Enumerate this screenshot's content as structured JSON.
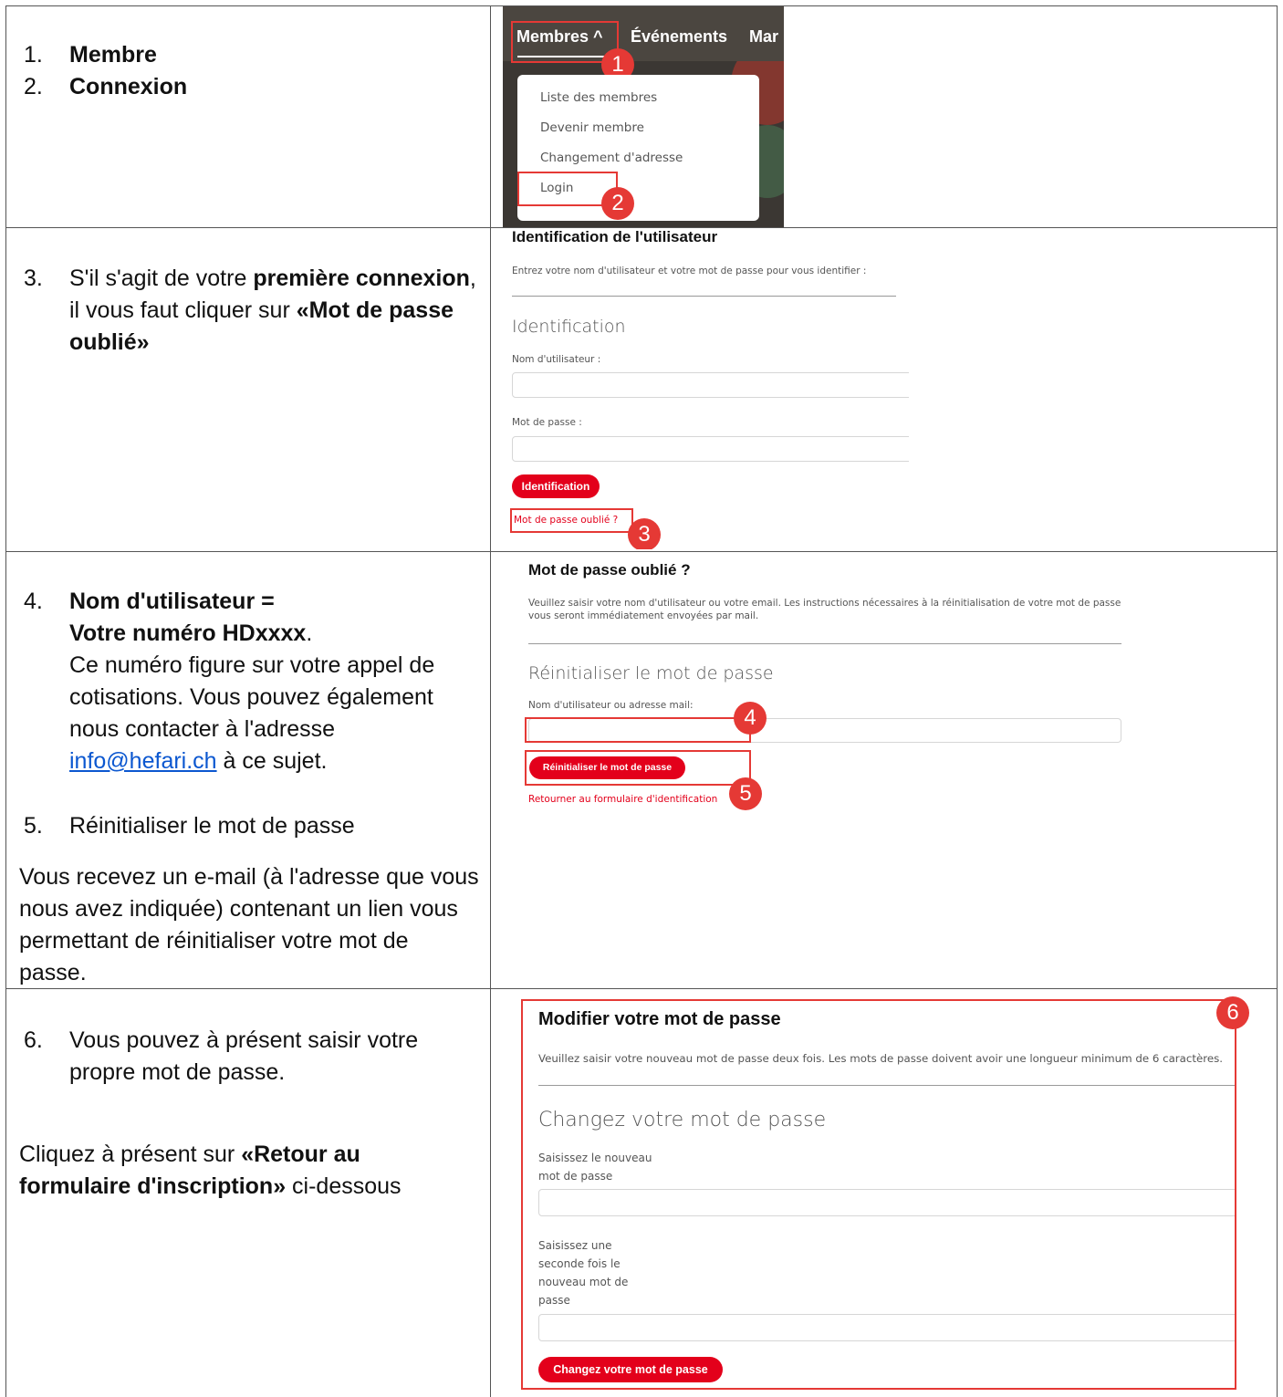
{
  "rows": {
    "r1": {
      "steps": [
        {
          "n": "1.",
          "text": "Membre"
        },
        {
          "n": "2.",
          "text": "Connexion"
        }
      ],
      "shot": {
        "nav": [
          "Membres ^",
          "Événements",
          "Mar"
        ],
        "menu": [
          "Liste des membres",
          "Devenir membre",
          "Changement d'adresse",
          "Login"
        ],
        "badges": [
          "1",
          "2"
        ]
      }
    },
    "r2": {
      "num": "3.",
      "text_a": "S'il s'agit de votre ",
      "bold_a": "première connexion",
      "text_b": ", il vous faut cliquer sur ",
      "bold_b": "«Mot de passe oublié»",
      "shot": {
        "title": "Identification de l'utilisateur",
        "intro": "Entrez votre nom d'utilisateur et votre mot de passe pour vous identifier :",
        "heading": "Identification",
        "user_label": "Nom d'utilisateur :",
        "pass_label": "Mot de passe :",
        "button": "Identification",
        "forgot": "Mot de passe oublié ?",
        "badge": "3"
      }
    },
    "r3": {
      "num4": "4.",
      "bold4a": "Nom d'utilisateur =",
      "bold4b": "Votre numéro HDxxxx",
      "dot": ".",
      "text4": "Ce numéro figure sur votre appel de cotisations. Vous pouvez également nous contacter à l'adresse ",
      "email": "info@hefari.ch",
      "text4_end": " à ce sujet.",
      "num5": "5.",
      "text5": "Réinitialiser le mot de passe",
      "note": "Vous recevez un e-mail (à l'adresse que vous nous avez indiquée) contenant un lien vous permettant de réinitialiser votre mot de passe.",
      "shot": {
        "title": "Mot de passe oublié ?",
        "intro": "Veuillez saisir votre nom d'utilisateur ou votre email. Les instructions nécessaires à la réinitialisation de votre mot de passe vous seront immédiatement envoyées par mail.",
        "heading": "Réinitialiser le mot de passe",
        "label": "Nom d'utilisateur ou adresse mail:",
        "button": "Réinitialiser le mot de passe",
        "back": "Retourner au formulaire d'identification",
        "badges": [
          "4",
          "5"
        ]
      }
    },
    "r4": {
      "num": "6.",
      "text6": "Vous pouvez à présent saisir votre propre mot de passe.",
      "click_a": "Cliquez à présent sur ",
      "click_bold": "«Retour au formulaire d'inscription»",
      "click_b": " ci-dessous",
      "shot": {
        "title": "Modifier votre mot de passe",
        "intro": "Veuillez saisir votre nouveau mot de passe deux fois. Les mots de passe doivent avoir une longueur minimum de 6 caractères.",
        "heading": "Changez votre mot de passe",
        "label1a": "Saisissez le nouveau",
        "label1b": "mot de passe",
        "label2a": "Saisissez une",
        "label2b": "seconde fois le",
        "label2c": "nouveau mot de",
        "label2d": "passe",
        "button": "Changez votre mot de passe",
        "badge": "6"
      }
    }
  },
  "colors": {
    "accent": "#e3001b",
    "annotation": "#e53935",
    "link": "#0b57d0"
  }
}
